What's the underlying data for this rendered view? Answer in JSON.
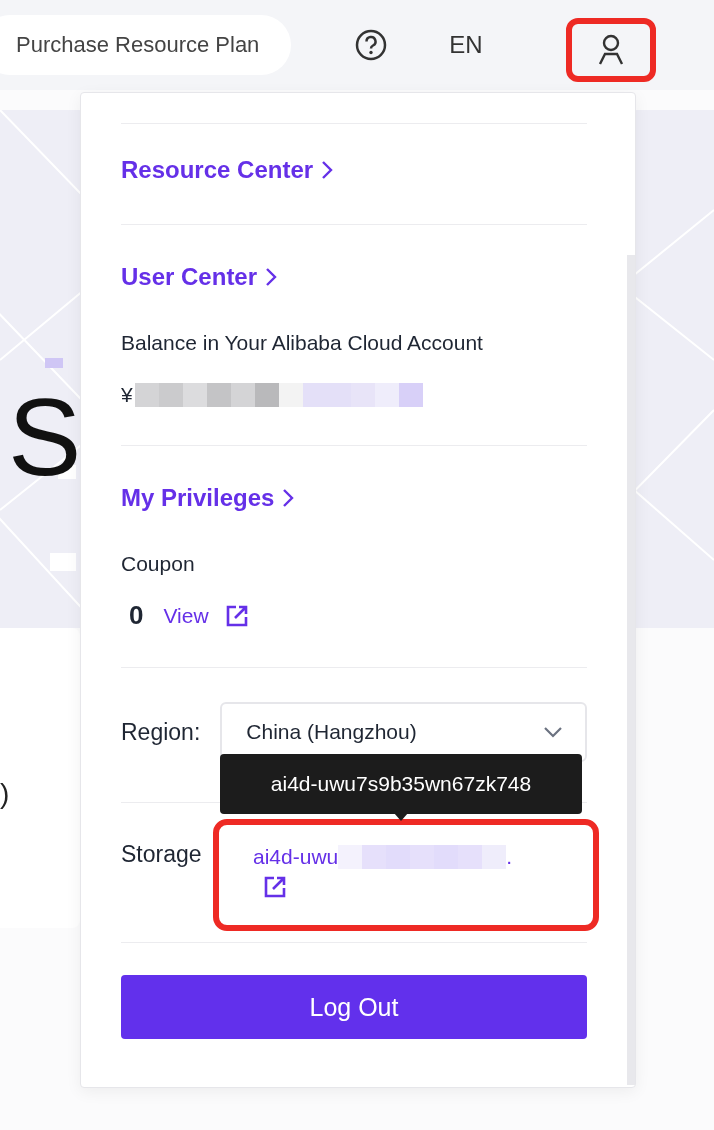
{
  "top_bar": {
    "purchase_button": "Purchase Resource Plan",
    "language": "EN"
  },
  "background": {
    "hero_left": "S",
    "card_text": ")"
  },
  "menu": {
    "resource_center": "Resource Center",
    "user_center": "User Center",
    "balance_label": "Balance in Your Alibaba Cloud Account",
    "currency": "¥",
    "privileges": "My Privileges",
    "coupon_label": "Coupon",
    "coupon_count": "0",
    "coupon_view": "View",
    "region_label": "Region:",
    "region_value": "China (Hangzhou)",
    "storage_label": "Storage",
    "storage_value": "ai4d-uwu",
    "storage_tail": ".",
    "logout": "Log Out"
  },
  "tooltip": {
    "text": "ai4d-uwu7s9b35wn67zk748"
  }
}
